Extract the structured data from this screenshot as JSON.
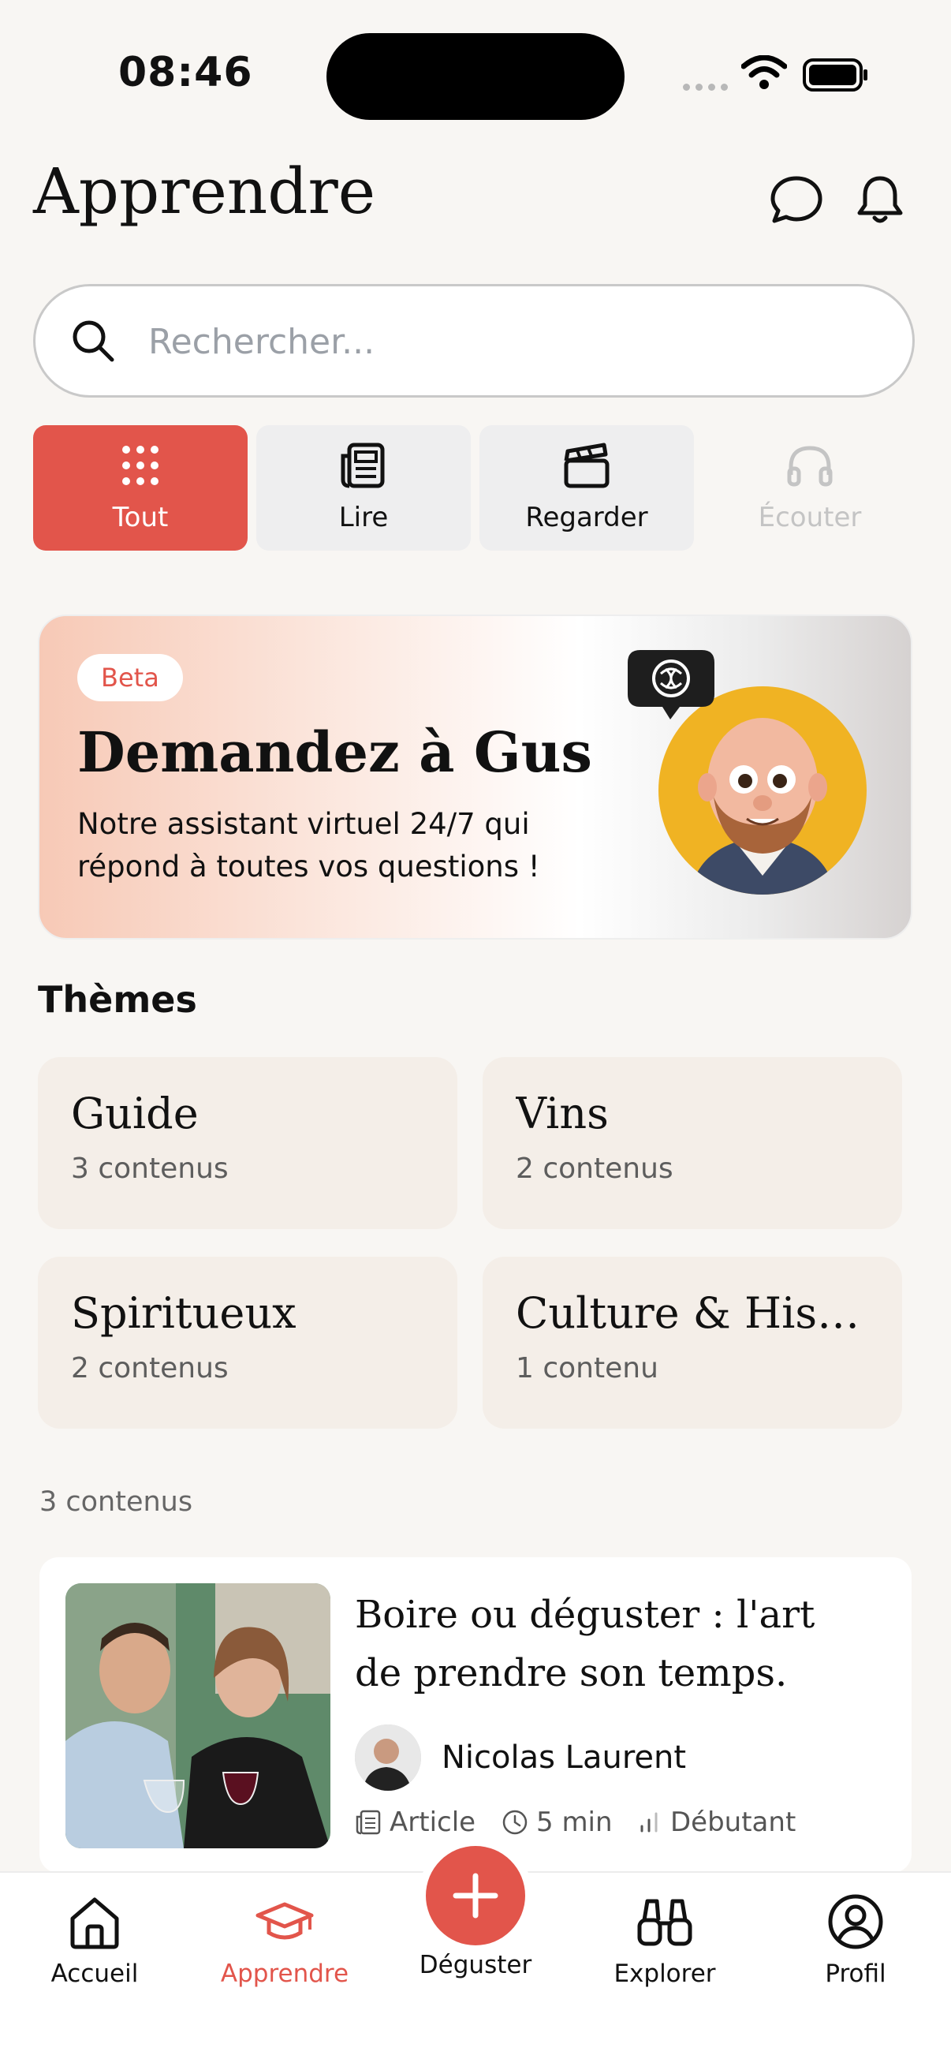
{
  "status_bar": {
    "time": "08:46"
  },
  "header": {
    "title": "Apprendre"
  },
  "search": {
    "placeholder": "Rechercher..."
  },
  "tabs": [
    {
      "label": "Tout",
      "icon": "grid-dots-icon",
      "state": "active"
    },
    {
      "label": "Lire",
      "icon": "newspaper-icon",
      "state": "normal"
    },
    {
      "label": "Regarder",
      "icon": "clapperboard-icon",
      "state": "normal"
    },
    {
      "label": "Écouter",
      "icon": "headphones-icon",
      "state": "disabled"
    }
  ],
  "banner": {
    "badge": "Beta",
    "title": "Demandez à Gus",
    "subtitle": "Notre assistant virtuel 24/7 qui répond à toutes vos questions !"
  },
  "themes": {
    "section_title": "Thèmes",
    "items": [
      {
        "name": "Guide",
        "count": "3 contenus"
      },
      {
        "name": "Vins",
        "count": "2 contenus"
      },
      {
        "name": "Spiritueux",
        "count": "2 contenus"
      },
      {
        "name": "Culture & Histoi...",
        "count": "1 contenu"
      }
    ]
  },
  "content_count": "3 contenus",
  "article": {
    "title": "Boire ou déguster : l'art de prendre son temps.",
    "author": "Nicolas Laurent",
    "type": "Article",
    "duration": "5 min",
    "level": "Débutant"
  },
  "bottom_nav": [
    {
      "label": "Accueil",
      "icon": "home-icon"
    },
    {
      "label": "Apprendre",
      "icon": "graduation-cap-icon"
    },
    {
      "label": "Déguster",
      "icon": "plus-icon"
    },
    {
      "label": "Explorer",
      "icon": "binoculars-icon"
    },
    {
      "label": "Profil",
      "icon": "user-circle-icon"
    }
  ],
  "colors": {
    "accent": "#e2554b",
    "background": "#f8f6f3",
    "theme_card": "#f4eee8"
  }
}
